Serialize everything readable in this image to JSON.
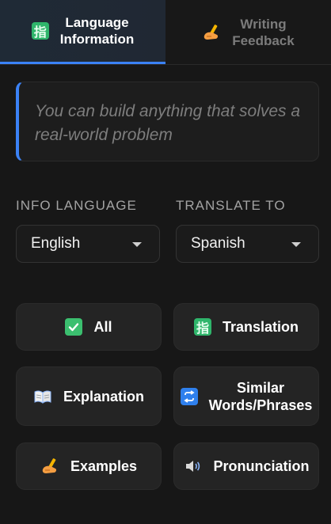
{
  "tabs": [
    {
      "label": "Language\nInformation",
      "icon": "han-character-icon",
      "active": true
    },
    {
      "label": "Writing\nFeedback",
      "icon": "writing-hand-icon",
      "active": false
    }
  ],
  "quote": {
    "text": "You can build anything that solves a real-world problem"
  },
  "selectors": {
    "info_language": {
      "label": "INFO LANGUAGE",
      "value": "English"
    },
    "translate_to": {
      "label": "TRANSLATE TO",
      "value": "Spanish"
    }
  },
  "categories": [
    {
      "label": "All",
      "icon": "check-icon"
    },
    {
      "label": "Translation",
      "icon": "han-character-icon"
    },
    {
      "label": "Explanation",
      "icon": "book-icon"
    },
    {
      "label": "Similar\nWords/Phrases",
      "icon": "repeat-icon"
    },
    {
      "label": "Examples",
      "icon": "writing-hand-icon"
    },
    {
      "label": "Pronunciation",
      "icon": "speaker-icon"
    }
  ],
  "colors": {
    "accent": "#3b82f6",
    "background": "#171717",
    "button": "#242424"
  }
}
